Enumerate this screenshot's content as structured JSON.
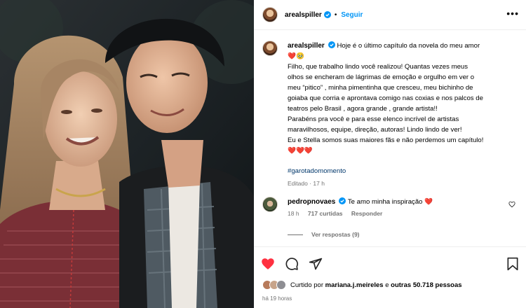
{
  "photo": {
    "alt_name": "couple-selfie-photo"
  },
  "post": {
    "author": "arealspiller",
    "follow_label": "Seguir",
    "more_label": "•••"
  },
  "caption": {
    "username": "arealspiller",
    "first_line": "Hoje é o último capítulo da novela do meu amor",
    "lines": [
      "❤️🥹",
      "Filho, que trabalho lindo você realizou! Quantas vezes meus",
      "olhos se encheram de lágrimas de emoção e orgulho em ver o",
      "meu “pitico” , minha pimentinha que cresceu, meu bichinho de",
      "goiaba que corria e aprontava comigo nas coxias e nos palcos de",
      "teatros pelo Brasil , agora grande , grande artista!!",
      "Parabéns pra você e para esse elenco incrível de artistas",
      "maravilhosos, equipe, direção, autoras! Lindo lindo de ver!",
      "Eu e Stella somos suas maiores fãs e não perdemos um capítulo!",
      "❤️❤️❤️"
    ],
    "hashtag": "#garotadomomento",
    "meta": "Editado · 17 h"
  },
  "comment": {
    "username": "pedropnovaes",
    "text": "Te amo minha inspiração ❤️",
    "time": "18 h",
    "likes": "717 curtidas",
    "reply_label": "Responder",
    "view_replies": "Ver respostas (9)"
  },
  "actions": {
    "likes_prefix": "Curtido por",
    "likes_user": "mariana.j.meireles",
    "likes_mid": "e",
    "likes_others": "outras 50.718 pessoas",
    "time_ago": "há 19 horas"
  },
  "colors": {
    "link": "#0095f6",
    "hashtag": "#00376b",
    "like_red": "#ff3040",
    "meta_gray": "#737373"
  }
}
